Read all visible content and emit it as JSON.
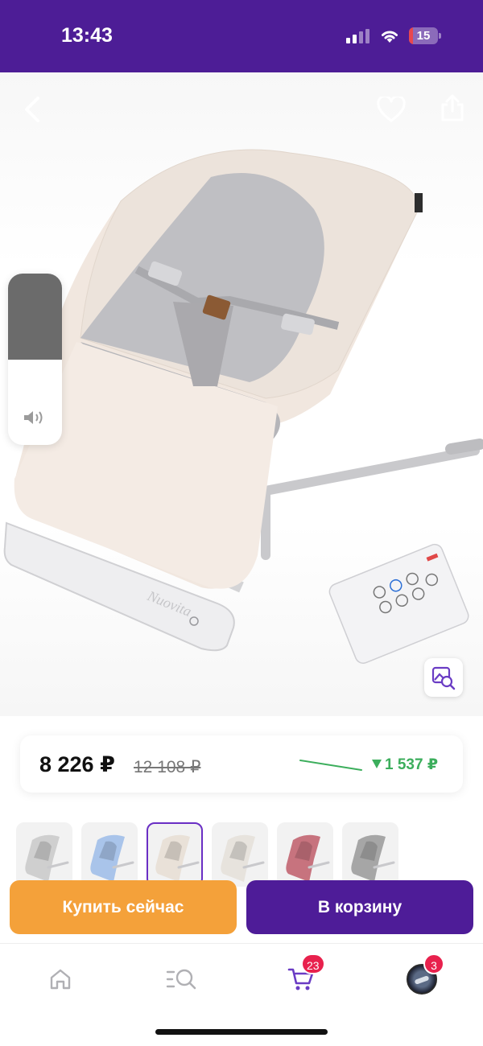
{
  "status_bar": {
    "time": "13:43",
    "battery": "15",
    "battery_level": 0.15
  },
  "hero": {
    "image_alt": "Детский шезлонг-качалка Nuovita с пультом",
    "brand_on_product": "Nuovita",
    "icons": {
      "back": "chevron-left-icon",
      "favorite": "heart-icon",
      "share": "share-icon",
      "visual_search": "image-search-icon"
    }
  },
  "volume_hud": {
    "level": 0.5,
    "icon": "speaker-icon"
  },
  "price": {
    "current": "8 226 ₽",
    "old": "12 108 ₽",
    "drop": "1 537 ₽"
  },
  "variants": [
    {
      "color": "#cfcfcf",
      "selected": false
    },
    {
      "color": "#a9c4ea",
      "selected": false
    },
    {
      "color": "#e9e1d8",
      "selected": true
    },
    {
      "color": "#e7e3dd",
      "selected": false
    },
    {
      "color": "#c7737e",
      "selected": false
    },
    {
      "color": "#a6a6a6",
      "selected": false
    }
  ],
  "actions": {
    "buy_now": "Купить сейчас",
    "add_to_cart": "В корзину"
  },
  "tab_bar": {
    "home_icon": "home-icon",
    "catalog_icon": "catalog-search-icon",
    "cart_icon": "cart-icon",
    "cart_badge": "23",
    "profile_badge": "3"
  },
  "colors": {
    "brand_purple": "#4d1d96",
    "buy_orange": "#f4a13a",
    "price_drop_green": "#3cae5c",
    "badge_red": "#e8214d"
  }
}
